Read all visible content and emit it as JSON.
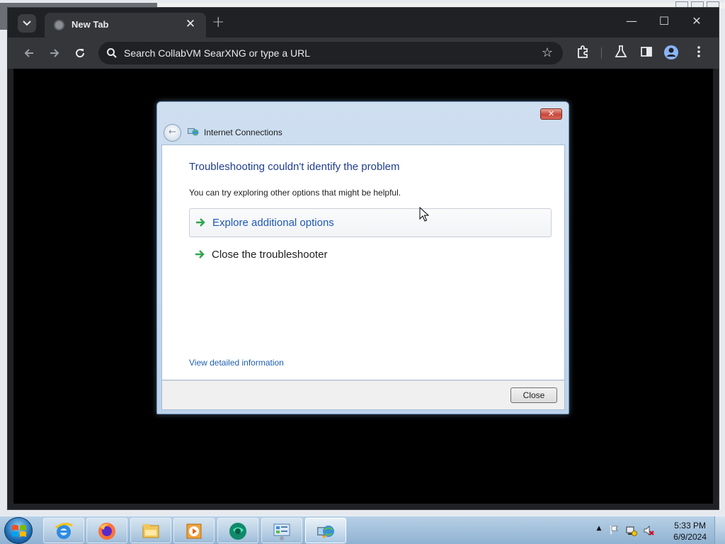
{
  "browser": {
    "tab": {
      "title": "New Tab",
      "close_glyph": "✕"
    },
    "new_tab_glyph": "+",
    "omnibox": {
      "placeholder": "Search CollabVM SearXNG or type a URL"
    },
    "window_controls": {
      "minimize": "—",
      "maximize": "☐",
      "close": "✕"
    }
  },
  "dialog": {
    "title": "Internet Connections",
    "heading": "Troubleshooting couldn't identify the problem",
    "subtext": "You can try exploring other options that might be helpful.",
    "options": [
      {
        "label": "Explore additional options"
      },
      {
        "label": "Close the troubleshooter"
      }
    ],
    "link": "View detailed information",
    "close_button": "Close",
    "close_glyph": "✕"
  },
  "taskbar": {
    "apps": [
      {
        "name": "internet-explorer-icon"
      },
      {
        "name": "firefox-icon"
      },
      {
        "name": "file-explorer-icon"
      },
      {
        "name": "media-player-icon"
      },
      {
        "name": "browser-app-icon"
      },
      {
        "name": "control-panel-icon"
      },
      {
        "name": "network-troubleshooter-icon"
      }
    ],
    "tray": {
      "show_hidden": "▲"
    },
    "clock": {
      "time": "5:33 PM",
      "date": "6/9/2024"
    }
  },
  "colors": {
    "chrome_dark": "#202124",
    "dialog_heading": "#1f3d91",
    "link": "#1f5fb0",
    "taskbar": "#a9c6e0"
  }
}
